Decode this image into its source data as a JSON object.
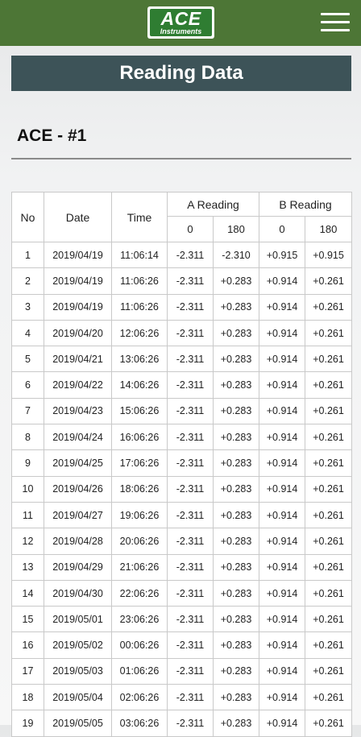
{
  "header": {
    "logo_main": "ACE",
    "logo_sub": "Instruments"
  },
  "page": {
    "banner_title": "Reading Data",
    "device_title": "ACE - #1"
  },
  "table": {
    "headers": {
      "no": "No",
      "date": "Date",
      "time": "Time",
      "a_reading": "A Reading",
      "b_reading": "B Reading",
      "a_0": "0",
      "a_180": "180",
      "b_0": "0",
      "b_180": "180"
    },
    "rows": [
      [
        "1",
        "2019/04/19",
        "11:06:14",
        "-2.311",
        "-2.310",
        "+0.915",
        "+0.915"
      ],
      [
        "2",
        "2019/04/19",
        "11:06:26",
        "-2.311",
        "+0.283",
        "+0.914",
        "+0.261"
      ],
      [
        "3",
        "2019/04/19",
        "11:06:26",
        "-2.311",
        "+0.283",
        "+0.914",
        "+0.261"
      ],
      [
        "4",
        "2019/04/20",
        "12:06:26",
        "-2.311",
        "+0.283",
        "+0.914",
        "+0.261"
      ],
      [
        "5",
        "2019/04/21",
        "13:06:26",
        "-2.311",
        "+0.283",
        "+0.914",
        "+0.261"
      ],
      [
        "6",
        "2019/04/22",
        "14:06:26",
        "-2.311",
        "+0.283",
        "+0.914",
        "+0.261"
      ],
      [
        "7",
        "2019/04/23",
        "15:06:26",
        "-2.311",
        "+0.283",
        "+0.914",
        "+0.261"
      ],
      [
        "8",
        "2019/04/24",
        "16:06:26",
        "-2.311",
        "+0.283",
        "+0.914",
        "+0.261"
      ],
      [
        "9",
        "2019/04/25",
        "17:06:26",
        "-2.311",
        "+0.283",
        "+0.914",
        "+0.261"
      ],
      [
        "10",
        "2019/04/26",
        "18:06:26",
        "-2.311",
        "+0.283",
        "+0.914",
        "+0.261"
      ],
      [
        "11",
        "2019/04/27",
        "19:06:26",
        "-2.311",
        "+0.283",
        "+0.914",
        "+0.261"
      ],
      [
        "12",
        "2019/04/28",
        "20:06:26",
        "-2.311",
        "+0.283",
        "+0.914",
        "+0.261"
      ],
      [
        "13",
        "2019/04/29",
        "21:06:26",
        "-2.311",
        "+0.283",
        "+0.914",
        "+0.261"
      ],
      [
        "14",
        "2019/04/30",
        "22:06:26",
        "-2.311",
        "+0.283",
        "+0.914",
        "+0.261"
      ],
      [
        "15",
        "2019/05/01",
        "23:06:26",
        "-2.311",
        "+0.283",
        "+0.914",
        "+0.261"
      ],
      [
        "16",
        "2019/05/02",
        "00:06:26",
        "-2.311",
        "+0.283",
        "+0.914",
        "+0.261"
      ],
      [
        "17",
        "2019/05/03",
        "01:06:26",
        "-2.311",
        "+0.283",
        "+0.914",
        "+0.261"
      ],
      [
        "18",
        "2019/05/04",
        "02:06:26",
        "-2.311",
        "+0.283",
        "+0.914",
        "+0.261"
      ],
      [
        "19",
        "2019/05/05",
        "03:06:26",
        "-2.311",
        "+0.283",
        "+0.914",
        "+0.261"
      ]
    ]
  },
  "colors": {
    "topbar": "#4d7636",
    "banner": "#3d5358",
    "logo_green": "#2f7d32"
  },
  "icons": {
    "menu": "hamburger-menu-icon"
  }
}
